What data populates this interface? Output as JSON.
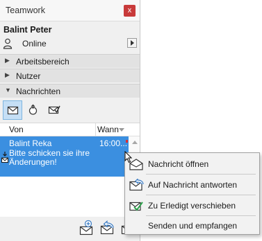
{
  "window": {
    "title": "Teamwork",
    "close_label": "x"
  },
  "user": {
    "name": "Balint Peter",
    "status": "Online"
  },
  "sections": [
    {
      "label": "Arbeitsbereich",
      "expanded": false
    },
    {
      "label": "Nutzer",
      "expanded": false
    },
    {
      "label": "Nachrichten",
      "expanded": true
    }
  ],
  "toolbar": {
    "icons": [
      "mail-icon",
      "new-message-icon",
      "mail-checkmark-icon"
    ]
  },
  "message_list": {
    "columns": [
      "Von",
      "Wann"
    ],
    "rows": [
      {
        "sender": "Balint Reka",
        "time": "16:00...",
        "subject": "Bitte schicken sie ihre Änderungen!"
      }
    ]
  },
  "bottom_toolbar": {
    "icons": [
      "new-mail-icon",
      "reply-mail-icon",
      "send-mail-icon"
    ]
  },
  "context_menu": {
    "items": [
      {
        "label": "Nachricht öffnen",
        "icon": "open-mail-icon"
      },
      {
        "label": "Auf Nachricht antworten",
        "icon": "reply-icon"
      },
      {
        "label": "Zu Erledigt verschieben",
        "icon": "done-checkmark-icon"
      },
      {
        "label": "Senden und empfangen",
        "icon": ""
      }
    ]
  },
  "colors": {
    "selection": "#3b8fe0",
    "close": "#c83a3a",
    "check": "#2aa34a"
  }
}
